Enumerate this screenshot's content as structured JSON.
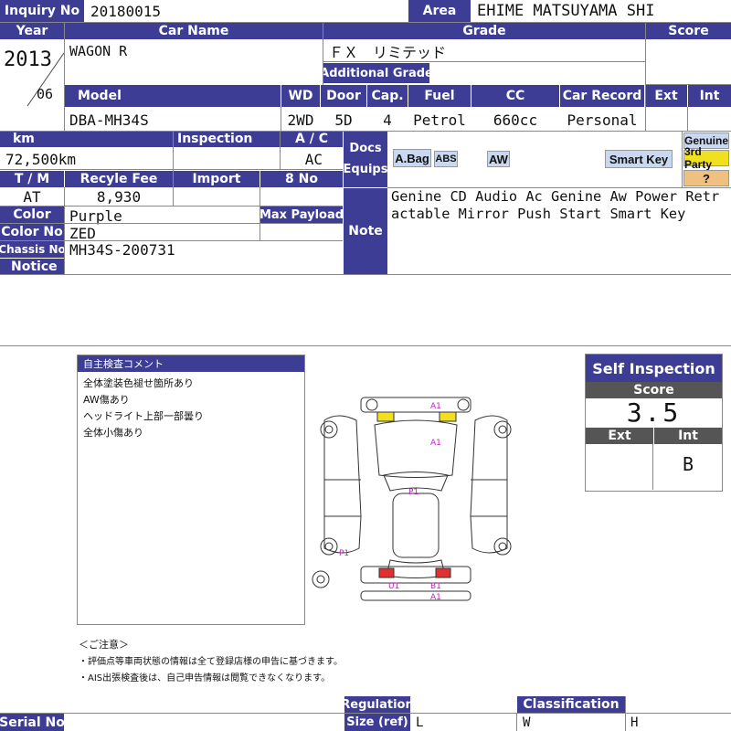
{
  "header": {
    "inquiry_no_label": "Inquiry No",
    "inquiry_no": "20180015",
    "area_label": "Area",
    "area": "EHIME MATSUYAMA SHI"
  },
  "row1": {
    "year_label": "Year",
    "car_name_label": "Car Name",
    "grade_label": "Grade",
    "score_label": "Score",
    "year": "2013",
    "month": "06",
    "car_name": "WAGON R",
    "grade": "ＦＸ　リミテッド",
    "additional_grade_label": "Additional Grade"
  },
  "row2": {
    "model_label": "Model",
    "wd_label": "WD",
    "door_label": "Door",
    "cap_label": "Cap.",
    "fuel_label": "Fuel",
    "cc_label": "CC",
    "car_record_label": "Car Record",
    "ext_label": "Ext",
    "int_label": "Int",
    "model": "DBA-MH34S",
    "wd": "2WD",
    "door": "5D",
    "cap": "4",
    "fuel": "Petrol",
    "cc": "660cc",
    "car_record": "Personal"
  },
  "row3": {
    "km_label": "km",
    "inspection_label": "Inspection",
    "ac_label": "A / C",
    "km": "72,500km",
    "ac": "AC",
    "docs_label": "Docs",
    "equips_label": "Equips",
    "tm_label": "T / M",
    "recycle_fee_label": "Recyle Fee",
    "import_label": "Import",
    "no8_label": "8 No",
    "tm": "AT",
    "recycle_fee": "8,930",
    "color_label": "Color",
    "color": "Purple",
    "max_payload_label": "Max Payload",
    "color_no_label": "Color No",
    "color_no": "ZED",
    "chassis_no_label": "Chassis No",
    "chassis_no": "MH34S-200731",
    "notice_label": "Notice",
    "note_label": "Note",
    "note": "Genine CD Audio Ac Genine Aw Power Retractable Mirror Push Start Smart Key"
  },
  "equips": {
    "abag": "A.Bag",
    "abs": "ABS",
    "aw": "AW",
    "smart_key": "Smart Key",
    "genuine": "Genuine",
    "third_party": "3rd Party",
    "question": "?"
  },
  "comments": {
    "title": "自主検査コメント",
    "lines": [
      "全体塗装色褪せ箇所あり",
      "AW傷あり",
      "ヘッドライト上部一部曇り",
      "全体小傷あり"
    ]
  },
  "diagram_marks": [
    "A1",
    "A1",
    "P1",
    "P1",
    "U1",
    "B1",
    "A1"
  ],
  "self_inspection": {
    "title": "Self Inspection",
    "score_label": "Score",
    "score": "3.5",
    "ext_label": "Ext",
    "int_label": "Int",
    "ext": "",
    "int": "B"
  },
  "caution": {
    "title": "＜ご注意＞",
    "line1": "・評価点等車両状態の情報は全て登録店様の申告に基づきます。",
    "line2": "・AIS出張検査後は、自己申告情報は閲覧できなくなります。"
  },
  "footer": {
    "serial_no_label": "Serial No",
    "regulation_label": "Regulation",
    "size_label": "Size (ref)",
    "classification_label": "Classification",
    "size_l": "L",
    "size_w": "W",
    "size_h": "H"
  },
  "colors": {
    "header_bg": "#3d3d96",
    "highlight_yellow": "#f0e020",
    "mark_red": "#e03030",
    "mark_magenta": "#c020c0",
    "badge_blue": "#c8d8f0",
    "badge_orange": "#f0c080"
  }
}
